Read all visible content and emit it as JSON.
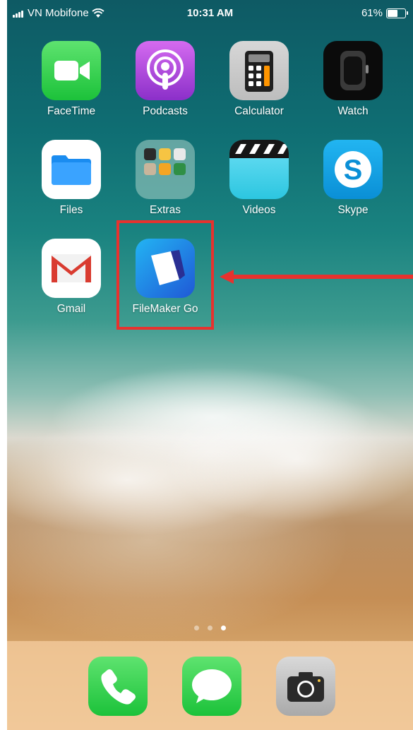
{
  "status_bar": {
    "carrier": "VN Mobifone",
    "time": "10:31 AM",
    "battery_percent": "61%",
    "battery_level": 0.61,
    "icons": [
      "signal-icon",
      "wifi-icon",
      "battery-icon"
    ]
  },
  "home": {
    "apps": [
      {
        "label": "FaceTime",
        "icon": "facetime-icon"
      },
      {
        "label": "Podcasts",
        "icon": "podcasts-icon"
      },
      {
        "label": "Calculator",
        "icon": "calculator-icon"
      },
      {
        "label": "Watch",
        "icon": "watch-icon"
      },
      {
        "label": "Files",
        "icon": "files-icon"
      },
      {
        "label": "Extras",
        "icon": "folder-icon"
      },
      {
        "label": "Videos",
        "icon": "videos-icon"
      },
      {
        "label": "Skype",
        "icon": "skype-icon"
      },
      {
        "label": "Gmail",
        "icon": "gmail-icon"
      },
      {
        "label": "FileMaker Go",
        "icon": "filemaker-icon"
      }
    ],
    "highlight": {
      "target": "FileMaker Go",
      "color": "#e7322e"
    }
  },
  "page_indicator": {
    "pages": 3,
    "current": 3
  },
  "dock": {
    "apps": [
      {
        "label": "Phone",
        "icon": "phone-icon"
      },
      {
        "label": "Messages",
        "icon": "messages-icon"
      },
      {
        "label": "Camera",
        "icon": "camera-icon"
      }
    ]
  }
}
